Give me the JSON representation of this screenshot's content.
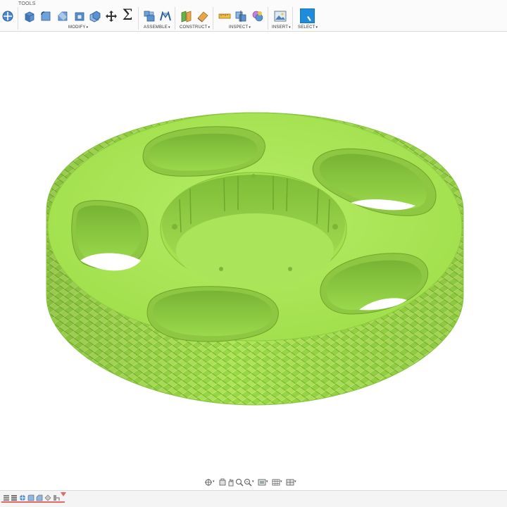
{
  "toolbar": {
    "tools_tab_label": "TOOLS",
    "groups": {
      "modify": "MODIFY",
      "assemble": "ASSEMBLE",
      "construct": "CONSTRUCT",
      "inspect": "INSPECT",
      "insert": "INSERT",
      "select": "SELECT"
    },
    "caret": "▾",
    "sigma": "Σ",
    "icons": {
      "sketch_move": "move-tool-icon",
      "press_pull": "press-pull-icon",
      "fillet": "fillet-icon",
      "chamfer": "chamfer-icon",
      "shell": "shell-icon",
      "combine": "combine-icon",
      "move": "move-arrows-icon",
      "compute_all": "sigma-icon",
      "new_component": "new-component-icon",
      "joint": "joint-icon",
      "offset_plane": "offset-plane-icon",
      "plane_at_angle": "plane-at-angle-icon",
      "measure": "measure-icon",
      "interference": "interference-icon",
      "display_component_colors": "component-colors-icon",
      "insert_image": "insert-image-icon",
      "select": "select-cursor-icon"
    }
  },
  "model": {
    "name": "knurled-spool-body",
    "color": "#a3e24e",
    "shadow_color": "#6fae2a",
    "highlight_color": "#c6f27c"
  },
  "navbar": {
    "icons": [
      "orbit-icon",
      "look-at-icon",
      "pan-icon",
      "zoom-window-icon",
      "zoom-icon",
      "display-settings-icon",
      "grid-icon",
      "viewports-icon"
    ],
    "caret": "▾"
  },
  "timeline": {
    "icons": [
      "go-to-start-icon",
      "previous-step-icon",
      "play-icon",
      "next-step-icon",
      "go-to-end-icon",
      "sketch-feature-icon",
      "extrude-feature-icon",
      "marker-icon"
    ],
    "accent": "#e06a6a"
  }
}
